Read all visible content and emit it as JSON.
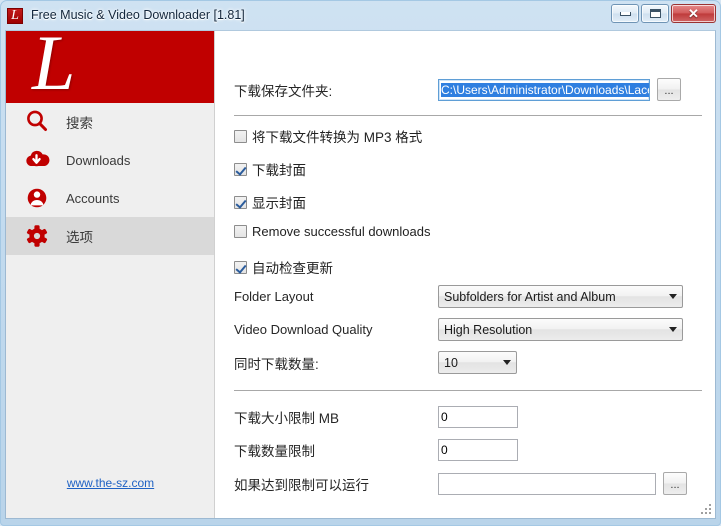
{
  "window": {
    "title": "Free Music & Video Downloader [1.81]",
    "icon": "app-logo-icon",
    "minimize_label": "Minimize",
    "maximize_label": "Maximize",
    "close_label": "✕"
  },
  "sidebar": {
    "logo_letter": "L",
    "items": [
      {
        "label": "搜索",
        "icon": "search-icon",
        "selected": false
      },
      {
        "label": "Downloads",
        "icon": "cloud-download-icon",
        "selected": false
      },
      {
        "label": "Accounts",
        "icon": "user-account-icon",
        "selected": false
      },
      {
        "label": "选项",
        "icon": "gear-icon",
        "selected": true
      }
    ],
    "site_link": "www.the-sz.com",
    "accent_color": "#c00000",
    "background_color": "#efefef",
    "selected_color": "#d9d9d9"
  },
  "options": {
    "download_folder": {
      "label": "下载保存文件夹:",
      "value": "C:\\Users\\Administrator\\Downloads\\Lacey\\",
      "selected": true,
      "browse_label": "..."
    },
    "checkboxes": [
      {
        "label": "将下载文件转换为 MP3 格式",
        "checked": false
      },
      {
        "label": "下载封面",
        "checked": true
      },
      {
        "label": "显示封面",
        "checked": true
      },
      {
        "label": "Remove successful downloads",
        "checked": false
      },
      {
        "label": "自动检查更新",
        "checked": true
      }
    ],
    "folder_layout": {
      "label": "Folder Layout",
      "value": "Subfolders for Artist and Album"
    },
    "video_quality": {
      "label": "Video Download Quality",
      "value": "High Resolution"
    },
    "simultaneous_downloads": {
      "label": "同时下载数量:",
      "value": "10"
    },
    "size_limit": {
      "label": "下载大小限制 MB",
      "value": "0"
    },
    "count_limit": {
      "label": "下载数量限制",
      "value": "0"
    },
    "run_on_limit": {
      "label": "如果达到限制可以运行",
      "value": "",
      "browse_label": "..."
    }
  }
}
